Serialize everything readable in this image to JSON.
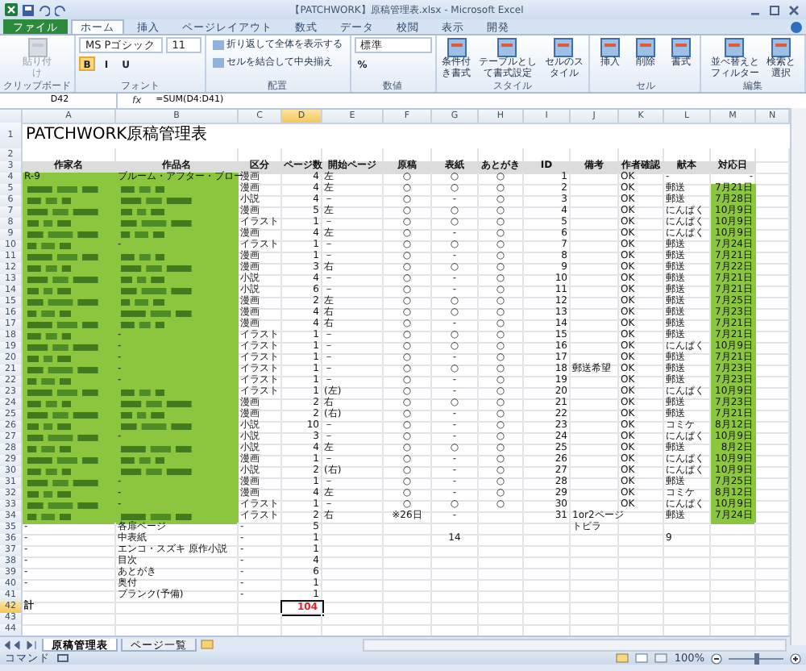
{
  "window": {
    "title": "【PATCHWORK】原稿管理表.xlsx - Microsoft Excel"
  },
  "tabs": [
    {
      "label": "ファイル",
      "kind": "file",
      "selected": false
    },
    {
      "label": "ホーム",
      "kind": "tab",
      "selected": true
    },
    {
      "label": "挿入",
      "kind": "tab",
      "selected": false
    },
    {
      "label": "ページレイアウト",
      "kind": "tab",
      "selected": false
    },
    {
      "label": "数式",
      "kind": "tab",
      "selected": false
    },
    {
      "label": "データ",
      "kind": "tab",
      "selected": false
    },
    {
      "label": "校閲",
      "kind": "tab",
      "selected": false
    },
    {
      "label": "表示",
      "kind": "tab",
      "selected": false
    },
    {
      "label": "開発",
      "kind": "tab",
      "selected": false
    }
  ],
  "ribbon": {
    "groups": [
      {
        "label": "クリップボード",
        "items": [
          {
            "kind": "large",
            "label": "貼り付け",
            "disabled": true
          }
        ]
      },
      {
        "label": "フォント",
        "items": [
          {
            "kind": "field",
            "value": "MS Pゴシック"
          },
          {
            "kind": "field",
            "value": "11"
          },
          {
            "kind": "letter",
            "label": "B",
            "selected": true
          },
          {
            "kind": "letter",
            "label": "I",
            "selected": false
          },
          {
            "kind": "letter",
            "label": "U",
            "selected": false
          }
        ]
      },
      {
        "label": "配置",
        "items": [
          {
            "kind": "wide",
            "label": "折り返して全体を表示する"
          },
          {
            "kind": "wide",
            "label": "セルを結合して中央揃え"
          }
        ]
      },
      {
        "label": "数値",
        "items": [
          {
            "kind": "field",
            "value": "標準"
          },
          {
            "kind": "letter",
            "label": "%",
            "selected": false
          }
        ]
      },
      {
        "label": "スタイル",
        "items": [
          {
            "kind": "large",
            "label": "条件付き書式",
            "disabled": false
          },
          {
            "kind": "large",
            "label": "テーブルとして書式設定",
            "disabled": false
          },
          {
            "kind": "large",
            "label": "セルのスタイル",
            "disabled": false
          }
        ]
      },
      {
        "label": "セル",
        "items": [
          {
            "kind": "large",
            "label": "挿入",
            "disabled": false
          },
          {
            "kind": "large",
            "label": "削除",
            "disabled": false
          },
          {
            "kind": "large",
            "label": "書式",
            "disabled": false
          }
        ]
      },
      {
        "label": "編集",
        "items": [
          {
            "kind": "large",
            "label": "並べ替えとフィルター",
            "disabled": false
          },
          {
            "kind": "large",
            "label": "検索と選択",
            "disabled": false
          }
        ]
      }
    ]
  },
  "formula_bar": {
    "name_box": "D42",
    "function_label": "fx",
    "formula": "=SUM(D4:D41)"
  },
  "columns": [
    {
      "label": "A",
      "selected": false
    },
    {
      "label": "B",
      "selected": false
    },
    {
      "label": "C",
      "selected": false
    },
    {
      "label": "D",
      "selected": true
    },
    {
      "label": "E",
      "selected": false
    },
    {
      "label": "F",
      "selected": false
    },
    {
      "label": "G",
      "selected": false
    },
    {
      "label": "H",
      "selected": false
    },
    {
      "label": "I",
      "selected": false
    },
    {
      "label": "J",
      "selected": false
    },
    {
      "label": "K",
      "selected": false
    },
    {
      "label": "L",
      "selected": false
    },
    {
      "label": "M",
      "selected": false
    },
    {
      "label": "N",
      "selected": false
    }
  ],
  "rows": [
    {
      "number": "1",
      "kind": "title",
      "selected": false,
      "text": "PATCHWORK原稿管理表"
    },
    {
      "number": "2",
      "kind": "blank",
      "selected": false
    },
    {
      "number": "3",
      "kind": "header",
      "selected": false,
      "author": "作家名",
      "title": "作品名",
      "category": "区分",
      "pages": "ページ数",
      "start_page": "開始ページ",
      "manuscript": "原稿",
      "cover": "表紙",
      "afterword": "あとがき",
      "id": "ID",
      "note": "備考",
      "author_check": "作者確認",
      "copy": "献本",
      "date": "対応日"
    },
    {
      "number": "4",
      "kind": "data",
      "selected": false,
      "highlight": true,
      "blurred": false,
      "date_marked": false,
      "author": "R-9",
      "title": "ブルーム・アフター・ブロー",
      "category": "漫画",
      "pages": "4",
      "start_page": "左",
      "manuscript": "○",
      "cover": "○",
      "afterword": "○",
      "id": "1",
      "author_check": "OK",
      "copy": "-",
      "date": "-"
    },
    {
      "number": "5",
      "kind": "data",
      "selected": false,
      "highlight": true,
      "blurred": true,
      "date_marked": true,
      "category": "漫画",
      "pages": "4",
      "start_page": "左",
      "manuscript": "○",
      "cover": "○",
      "afterword": "○",
      "id": "2",
      "author_check": "OK",
      "copy": "郵送",
      "date": "7月21日"
    },
    {
      "number": "6",
      "kind": "data",
      "selected": false,
      "highlight": true,
      "blurred": true,
      "date_marked": true,
      "category": "小説",
      "pages": "4",
      "start_page": "－",
      "manuscript": "○",
      "cover": "-",
      "afterword": "○",
      "id": "3",
      "author_check": "OK",
      "copy": "郵送",
      "date": "7月28日"
    },
    {
      "number": "7",
      "kind": "data",
      "selected": false,
      "highlight": true,
      "blurred": true,
      "date_marked": true,
      "category": "漫画",
      "pages": "5",
      "start_page": "左",
      "manuscript": "○",
      "cover": "○",
      "afterword": "○",
      "id": "4",
      "author_check": "OK",
      "copy": "にんぱく",
      "date": "10月9日"
    },
    {
      "number": "8",
      "kind": "data",
      "selected": false,
      "highlight": true,
      "blurred": true,
      "date_marked": true,
      "category": "イラスト",
      "pages": "1",
      "start_page": "－",
      "manuscript": "○",
      "cover": "○",
      "afterword": "○",
      "id": "5",
      "author_check": "OK",
      "copy": "にんぱく",
      "date": "10月9日"
    },
    {
      "number": "9",
      "kind": "data",
      "selected": false,
      "highlight": true,
      "blurred": true,
      "date_marked": true,
      "category": "漫画",
      "pages": "4",
      "start_page": "左",
      "manuscript": "○",
      "cover": "-",
      "afterword": "○",
      "id": "6",
      "author_check": "OK",
      "copy": "にんぱく",
      "date": "10月9日"
    },
    {
      "number": "10",
      "kind": "data",
      "selected": false,
      "highlight": true,
      "blurred": true,
      "date_marked": true,
      "title": "-",
      "category": "イラスト",
      "pages": "1",
      "start_page": "－",
      "manuscript": "○",
      "cover": "○",
      "afterword": "○",
      "id": "7",
      "author_check": "OK",
      "copy": "郵送",
      "date": "7月24日"
    },
    {
      "number": "11",
      "kind": "data",
      "selected": false,
      "highlight": true,
      "blurred": true,
      "date_marked": true,
      "category": "漫画",
      "pages": "1",
      "start_page": "－",
      "manuscript": "○",
      "cover": "-",
      "afterword": "○",
      "id": "8",
      "author_check": "OK",
      "copy": "郵送",
      "date": "7月21日"
    },
    {
      "number": "12",
      "kind": "data",
      "selected": false,
      "highlight": true,
      "blurred": true,
      "date_marked": true,
      "category": "漫画",
      "pages": "3",
      "start_page": "右",
      "manuscript": "○",
      "cover": "○",
      "afterword": "○",
      "id": "9",
      "author_check": "OK",
      "copy": "郵送",
      "date": "7月22日"
    },
    {
      "number": "13",
      "kind": "data",
      "selected": false,
      "highlight": true,
      "blurred": true,
      "date_marked": true,
      "category": "小説",
      "pages": "4",
      "start_page": "－",
      "manuscript": "○",
      "cover": "-",
      "afterword": "○",
      "id": "10",
      "author_check": "OK",
      "copy": "郵送",
      "date": "7月21日"
    },
    {
      "number": "14",
      "kind": "data",
      "selected": false,
      "highlight": true,
      "blurred": true,
      "date_marked": true,
      "category": "小説",
      "pages": "6",
      "start_page": "－",
      "manuscript": "○",
      "cover": "-",
      "afterword": "○",
      "id": "11",
      "author_check": "OK",
      "copy": "郵送",
      "date": "7月21日"
    },
    {
      "number": "15",
      "kind": "data",
      "selected": false,
      "highlight": true,
      "blurred": true,
      "date_marked": true,
      "category": "漫画",
      "pages": "2",
      "start_page": "左",
      "manuscript": "○",
      "cover": "○",
      "afterword": "○",
      "id": "12",
      "author_check": "OK",
      "copy": "郵送",
      "date": "7月25日"
    },
    {
      "number": "16",
      "kind": "data",
      "selected": false,
      "highlight": true,
      "blurred": true,
      "date_marked": true,
      "category": "漫画",
      "pages": "4",
      "start_page": "右",
      "manuscript": "○",
      "cover": "○",
      "afterword": "○",
      "id": "13",
      "author_check": "OK",
      "copy": "郵送",
      "date": "7月23日"
    },
    {
      "number": "17",
      "kind": "data",
      "selected": false,
      "highlight": true,
      "blurred": true,
      "date_marked": true,
      "category": "漫画",
      "pages": "4",
      "start_page": "右",
      "manuscript": "○",
      "cover": "-",
      "afterword": "○",
      "id": "14",
      "author_check": "OK",
      "copy": "郵送",
      "date": "7月21日"
    },
    {
      "number": "18",
      "kind": "data",
      "selected": false,
      "highlight": true,
      "blurred": true,
      "date_marked": true,
      "title": "-",
      "category": "イラスト",
      "pages": "1",
      "start_page": "－",
      "manuscript": "○",
      "cover": "○",
      "afterword": "○",
      "id": "15",
      "author_check": "OK",
      "copy": "郵送",
      "date": "7月21日"
    },
    {
      "number": "19",
      "kind": "data",
      "selected": false,
      "highlight": true,
      "blurred": true,
      "date_marked": true,
      "title": "-",
      "category": "イラスト",
      "pages": "1",
      "start_page": "－",
      "manuscript": "○",
      "cover": "○",
      "afterword": "○",
      "id": "16",
      "author_check": "OK",
      "copy": "にんぱく",
      "date": "10月9日"
    },
    {
      "number": "20",
      "kind": "data",
      "selected": false,
      "highlight": true,
      "blurred": true,
      "date_marked": true,
      "title": "-",
      "category": "イラスト",
      "pages": "1",
      "start_page": "－",
      "manuscript": "○",
      "cover": "-",
      "afterword": "○",
      "id": "17",
      "author_check": "OK",
      "copy": "郵送",
      "date": "7月21日"
    },
    {
      "number": "21",
      "kind": "data",
      "selected": false,
      "highlight": true,
      "blurred": true,
      "date_marked": true,
      "title": "-",
      "category": "イラスト",
      "pages": "1",
      "start_page": "－",
      "manuscript": "○",
      "cover": "○",
      "afterword": "○",
      "id": "18",
      "note": "郵送希望",
      "author_check": "OK",
      "copy": "郵送",
      "date": "7月23日"
    },
    {
      "number": "22",
      "kind": "data",
      "selected": false,
      "highlight": true,
      "blurred": true,
      "date_marked": true,
      "title": "-",
      "category": "イラスト",
      "pages": "1",
      "start_page": "－",
      "manuscript": "○",
      "cover": "-",
      "afterword": "○",
      "id": "19",
      "author_check": "OK",
      "copy": "郵送",
      "date": "7月23日"
    },
    {
      "number": "23",
      "kind": "data",
      "selected": false,
      "highlight": true,
      "blurred": true,
      "date_marked": true,
      "category": "イラスト",
      "pages": "1",
      "start_page": "(左)",
      "manuscript": "○",
      "cover": "-",
      "afterword": "○",
      "id": "20",
      "author_check": "OK",
      "copy": "にんぱく",
      "date": "10月9日"
    },
    {
      "number": "24",
      "kind": "data",
      "selected": false,
      "highlight": true,
      "blurred": true,
      "date_marked": true,
      "category": "漫画",
      "pages": "2",
      "start_page": "右",
      "manuscript": "○",
      "cover": "○",
      "afterword": "○",
      "id": "21",
      "author_check": "OK",
      "copy": "郵送",
      "date": "7月23日"
    },
    {
      "number": "25",
      "kind": "data",
      "selected": false,
      "highlight": true,
      "blurred": true,
      "date_marked": true,
      "category": "漫画",
      "pages": "2",
      "start_page": "(右)",
      "manuscript": "○",
      "cover": "-",
      "afterword": "○",
      "id": "22",
      "author_check": "OK",
      "copy": "郵送",
      "date": "7月21日"
    },
    {
      "number": "26",
      "kind": "data",
      "selected": false,
      "highlight": true,
      "blurred": true,
      "date_marked": true,
      "category": "小説",
      "pages": "10",
      "start_page": "－",
      "manuscript": "○",
      "cover": "-",
      "afterword": "○",
      "id": "23",
      "author_check": "OK",
      "copy": "コミケ",
      "date": "8月12日"
    },
    {
      "number": "27",
      "kind": "data",
      "selected": false,
      "highlight": true,
      "blurred": true,
      "date_marked": true,
      "title": "-",
      "category": "小説",
      "pages": "3",
      "start_page": "－",
      "manuscript": "○",
      "cover": "-",
      "afterword": "○",
      "id": "24",
      "author_check": "OK",
      "copy": "にんぱく",
      "date": "10月9日"
    },
    {
      "number": "28",
      "kind": "data",
      "selected": false,
      "highlight": true,
      "blurred": true,
      "date_marked": true,
      "category": "小説",
      "pages": "4",
      "start_page": "左",
      "manuscript": "○",
      "cover": "○",
      "afterword": "○",
      "id": "25",
      "author_check": "OK",
      "copy": "郵送",
      "date": "8月2日"
    },
    {
      "number": "29",
      "kind": "data",
      "selected": false,
      "highlight": true,
      "blurred": true,
      "date_marked": true,
      "category": "漫画",
      "pages": "1",
      "start_page": "－",
      "manuscript": "○",
      "cover": "-",
      "afterword": "○",
      "id": "26",
      "author_check": "OK",
      "copy": "にんぱく",
      "date": "10月9日"
    },
    {
      "number": "30",
      "kind": "data",
      "selected": false,
      "highlight": true,
      "blurred": true,
      "date_marked": true,
      "category": "小説",
      "pages": "2",
      "start_page": "(右)",
      "manuscript": "○",
      "cover": "-",
      "afterword": "○",
      "id": "27",
      "author_check": "OK",
      "copy": "にんぱく",
      "date": "10月9日"
    },
    {
      "number": "31",
      "kind": "data",
      "selected": false,
      "highlight": true,
      "blurred": true,
      "date_marked": true,
      "title": "-",
      "category": "漫画",
      "pages": "1",
      "start_page": "－",
      "manuscript": "○",
      "cover": "-",
      "afterword": "○",
      "id": "28",
      "author_check": "OK",
      "copy": "郵送",
      "date": "7月25日"
    },
    {
      "number": "32",
      "kind": "data",
      "selected": false,
      "highlight": true,
      "blurred": true,
      "date_marked": true,
      "title": "-",
      "category": "漫画",
      "pages": "4",
      "start_page": "左",
      "manuscript": "○",
      "cover": "-",
      "afterword": "○",
      "id": "29",
      "author_check": "OK",
      "copy": "コミケ",
      "date": "8月12日"
    },
    {
      "number": "33",
      "kind": "data",
      "selected": false,
      "highlight": true,
      "blurred": true,
      "date_marked": true,
      "title": "-",
      "category": "イラスト",
      "pages": "1",
      "start_page": "－",
      "manuscript": "○",
      "cover": "○",
      "afterword": "○",
      "id": "30",
      "author_check": "OK",
      "copy": "にんぱく",
      "date": "10月9日"
    },
    {
      "number": "34",
      "kind": "data",
      "selected": false,
      "highlight": true,
      "blurred": true,
      "date_marked": true,
      "category": "イラスト",
      "pages": "2",
      "start_page": "右",
      "manuscript": "※26日",
      "cover": "-",
      "id": "31",
      "note": "1or2ページ",
      "copy": "郵送",
      "date": "7月24日"
    },
    {
      "number": "35",
      "kind": "data",
      "selected": false,
      "highlight": false,
      "author": "-",
      "title": "各扉ページ",
      "category": "-",
      "pages": "5",
      "note": "トビラ"
    },
    {
      "number": "36",
      "kind": "data",
      "selected": false,
      "highlight": false,
      "author": "-",
      "title": "中表紙",
      "category": "-",
      "pages": "1",
      "cover": "14",
      "copy": "9"
    },
    {
      "number": "37",
      "kind": "data",
      "selected": false,
      "highlight": false,
      "author": "-",
      "title": "エンコ・スズキ 原作小説",
      "category": "-",
      "pages": "1"
    },
    {
      "number": "38",
      "kind": "data",
      "selected": false,
      "highlight": false,
      "author": "-",
      "title": "目次",
      "category": "-",
      "pages": "4"
    },
    {
      "number": "39",
      "kind": "data",
      "selected": false,
      "highlight": false,
      "author": "-",
      "title": "あとがき",
      "category": "-",
      "pages": "6"
    },
    {
      "number": "40",
      "kind": "data",
      "selected": false,
      "highlight": false,
      "author": "-",
      "title": "奥付",
      "category": "-",
      "pages": "1"
    },
    {
      "number": "41",
      "kind": "data",
      "selected": false,
      "highlight": false,
      "title": "ブランク(予備)",
      "category": "-",
      "pages": "1"
    },
    {
      "number": "42",
      "kind": "total",
      "selected": true,
      "author": "計",
      "pages": "104"
    },
    {
      "number": "43",
      "kind": "blank",
      "selected": false
    },
    {
      "number": "44",
      "kind": "blank",
      "selected": false
    }
  ],
  "sheet_tabs": [
    {
      "label": "原稿管理表",
      "selected": true
    },
    {
      "label": "ページ一覧",
      "selected": false
    }
  ],
  "status_bar": {
    "mode": "コマンド",
    "zoom": "100%",
    "level": 0.5
  }
}
